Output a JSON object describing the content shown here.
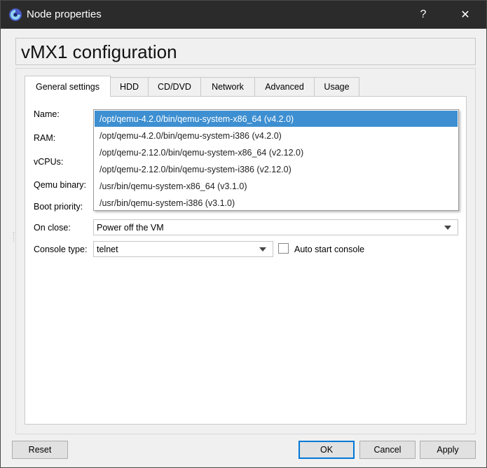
{
  "window": {
    "title": "Node properties",
    "help_glyph": "?",
    "close_glyph": "✕"
  },
  "header": {
    "title": "vMX1 configuration"
  },
  "tabs": [
    {
      "label": "General settings",
      "active": true
    },
    {
      "label": "HDD"
    },
    {
      "label": "CD/DVD"
    },
    {
      "label": "Network"
    },
    {
      "label": "Advanced"
    },
    {
      "label": "Usage"
    }
  ],
  "form": {
    "name_label": "Name:",
    "ram_label": "RAM:",
    "vcpus_label": "vCPUs:",
    "qemu_binary_label": "Qemu binary:",
    "boot_priority_label": "Boot priority:",
    "on_close_label": "On close:",
    "on_close_value": "Power off the VM",
    "console_type_label": "Console type:",
    "console_type_value": "telnet",
    "auto_start_label": "Auto start console",
    "auto_start_checked": false
  },
  "qemu_dropdown": {
    "items": [
      "/opt/qemu-4.2.0/bin/qemu-system-x86_64 (v4.2.0)",
      "/opt/qemu-4.2.0/bin/qemu-system-i386 (v4.2.0)",
      "/opt/qemu-2.12.0/bin/qemu-system-x86_64 (v2.12.0)",
      "/opt/qemu-2.12.0/bin/qemu-system-i386 (v2.12.0)",
      "/usr/bin/qemu-system-x86_64 (v3.1.0)",
      "/usr/bin/qemu-system-i386 (v3.1.0)"
    ],
    "selected_index": 0
  },
  "buttons": {
    "reset": "Reset",
    "ok": "OK",
    "cancel": "Cancel",
    "apply": "Apply"
  },
  "colors": {
    "titlebar": "#2b2b2b",
    "selection": "#3d8fd1",
    "default_button_border": "#0078d7"
  }
}
